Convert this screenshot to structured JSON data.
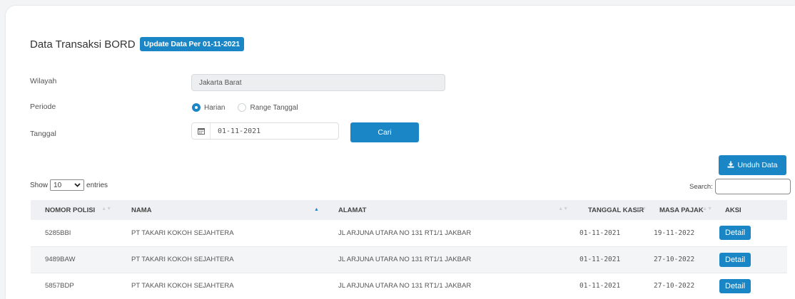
{
  "page": {
    "title": "Data Transaksi BORD",
    "update_badge": "Update Data Per 01-11-2021"
  },
  "form": {
    "wilayah_label": "Wilayah",
    "wilayah_value": "Jakarta Barat",
    "periode_label": "Periode",
    "periode_options": [
      "Harian",
      "Range Tanggal"
    ],
    "periode_selected": "Harian",
    "tanggal_label": "Tanggal",
    "tanggal_value": "01-11-2021",
    "cari_label": "Cari"
  },
  "actions": {
    "unduh_label": "Unduh Data"
  },
  "table_controls": {
    "show_label": "Show",
    "entries_value": "10",
    "entries_label": "entries",
    "search_label": "Search:"
  },
  "table": {
    "columns": [
      "NOMOR POLISI",
      "NAMA",
      "ALAMAT",
      "TANGGAL KASIR",
      "MASA PAJAK",
      "AKSI"
    ],
    "rows": [
      {
        "nomor_polisi": "5285BBI",
        "nama": "PT TAKARI KOKOH SEJAHTERA",
        "alamat": "JL ARJUNA UTARA NO 131 RT1/1 JAKBAR",
        "tanggal_kasir": "01-11-2021",
        "masa_pajak": "19-11-2022",
        "aksi": "Detail"
      },
      {
        "nomor_polisi": "9489BAW",
        "nama": "PT TAKARI KOKOH SEJAHTERA",
        "alamat": "JL ARJUNA UTARA NO 131 RT1/1 JAKBAR",
        "tanggal_kasir": "01-11-2021",
        "masa_pajak": "27-10-2022",
        "aksi": "Detail"
      },
      {
        "nomor_polisi": "5857BDP",
        "nama": "PT TAKARI KOKOH SEJAHTERA",
        "alamat": "JL ARJUNA UTARA NO 131 RT1/1 JAKBAR",
        "tanggal_kasir": "01-11-2021",
        "masa_pajak": "27-10-2022",
        "aksi": "Detail"
      }
    ]
  },
  "colors": {
    "accent": "#1b86c6",
    "header_bg": "#eef0f3"
  },
  "icons": {
    "calendar": "calendar-icon",
    "download": "download-icon",
    "dropdown": "chevron-down-icon",
    "sort": "sort-icon"
  }
}
